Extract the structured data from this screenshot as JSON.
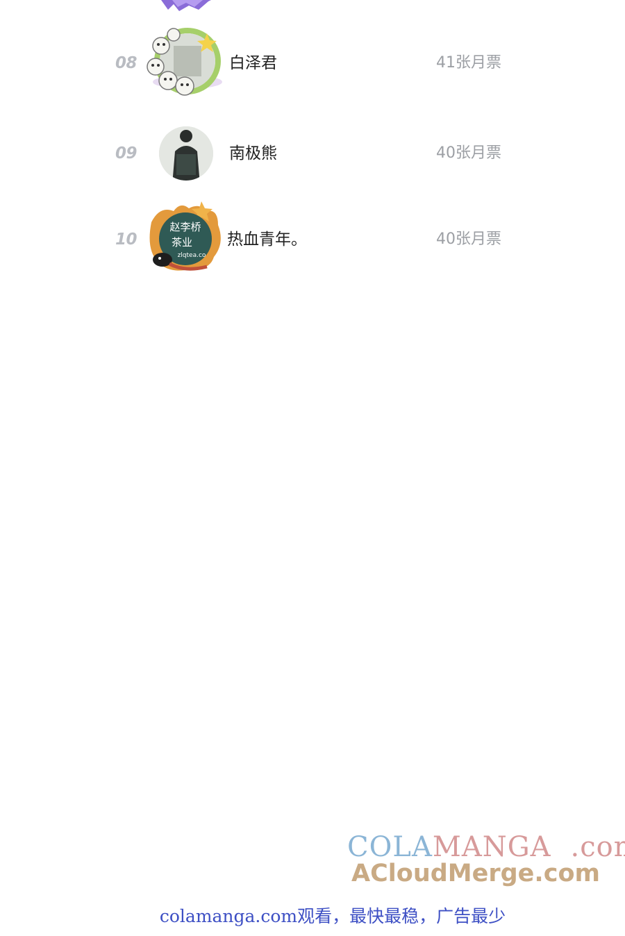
{
  "leaderboard": {
    "rows": [
      {
        "rank": "08",
        "name": "白泽君",
        "tickets": "41张月票",
        "avatar_icon": "sheep-frame-avatar-icon"
      },
      {
        "rank": "09",
        "name": "南极熊",
        "tickets": "40张月票",
        "avatar_icon": "dark-figure-avatar-icon"
      },
      {
        "rank": "10",
        "name": "热血青年。",
        "tickets": "40张月票",
        "avatar_icon": "tea-sign-avatar-icon"
      }
    ],
    "avatar_10_sign": {
      "line1": "赵李桥",
      "line2": "茶业",
      "domain": "zlqtea.co"
    }
  },
  "watermark": {
    "brand_part1": "COLA",
    "brand_part2": "MANGA",
    "brand_part3": ".com",
    "brand_line2": "ACloudMerge.com"
  },
  "footer": {
    "note": "colamanga.com观看，最快最稳，广告最少"
  },
  "colors": {
    "rank_number": "#b9bcc2",
    "name_text": "#222222",
    "ticket_text": "#9c9fa4",
    "footer_link": "#3d4fc4",
    "watermark_blue": "#8bb5d6",
    "watermark_pink": "#d79a9a",
    "watermark_tan": "#c9aa84"
  }
}
